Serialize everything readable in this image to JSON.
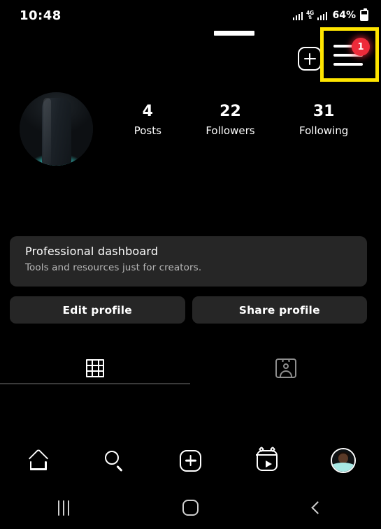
{
  "status_bar": {
    "time": "10:48",
    "network_label": "4G",
    "network_arrows": "↕",
    "battery_percent": "64%",
    "signal_icon": "cellular-signal-icon",
    "battery_icon": "battery-icon"
  },
  "app_header": {
    "username": "",
    "add_post_icon": "plus-square-icon",
    "menu_icon": "hamburger-menu-icon",
    "menu_badge_count": "1",
    "badge_color": "#ED2B3A",
    "highlight_color": "#FFE500"
  },
  "profile": {
    "avatar_icon": "profile-avatar",
    "stats": [
      {
        "count": "4",
        "label": "Posts"
      },
      {
        "count": "22",
        "label": "Followers"
      },
      {
        "count": "31",
        "label": "Following"
      }
    ]
  },
  "dashboard_card": {
    "title": "Professional dashboard",
    "subtitle": "Tools and resources just for creators.",
    "background": "#262626"
  },
  "action_buttons": [
    {
      "label": "Edit profile"
    },
    {
      "label": "Share profile"
    }
  ],
  "tabs": [
    {
      "name": "grid",
      "icon": "grid-icon",
      "active": true
    },
    {
      "name": "tagged",
      "icon": "tagged-person-icon",
      "active": false
    }
  ],
  "bottom_nav": [
    {
      "name": "home",
      "icon": "home-icon"
    },
    {
      "name": "search",
      "icon": "search-icon"
    },
    {
      "name": "create",
      "icon": "plus-square-icon"
    },
    {
      "name": "reels",
      "icon": "reels-icon"
    },
    {
      "name": "profile",
      "icon": "profile-avatar-icon"
    }
  ],
  "system_nav": [
    {
      "name": "recents",
      "icon": "recents-icon"
    },
    {
      "name": "home",
      "icon": "home-square-icon"
    },
    {
      "name": "back",
      "icon": "back-chevron-icon"
    }
  ]
}
